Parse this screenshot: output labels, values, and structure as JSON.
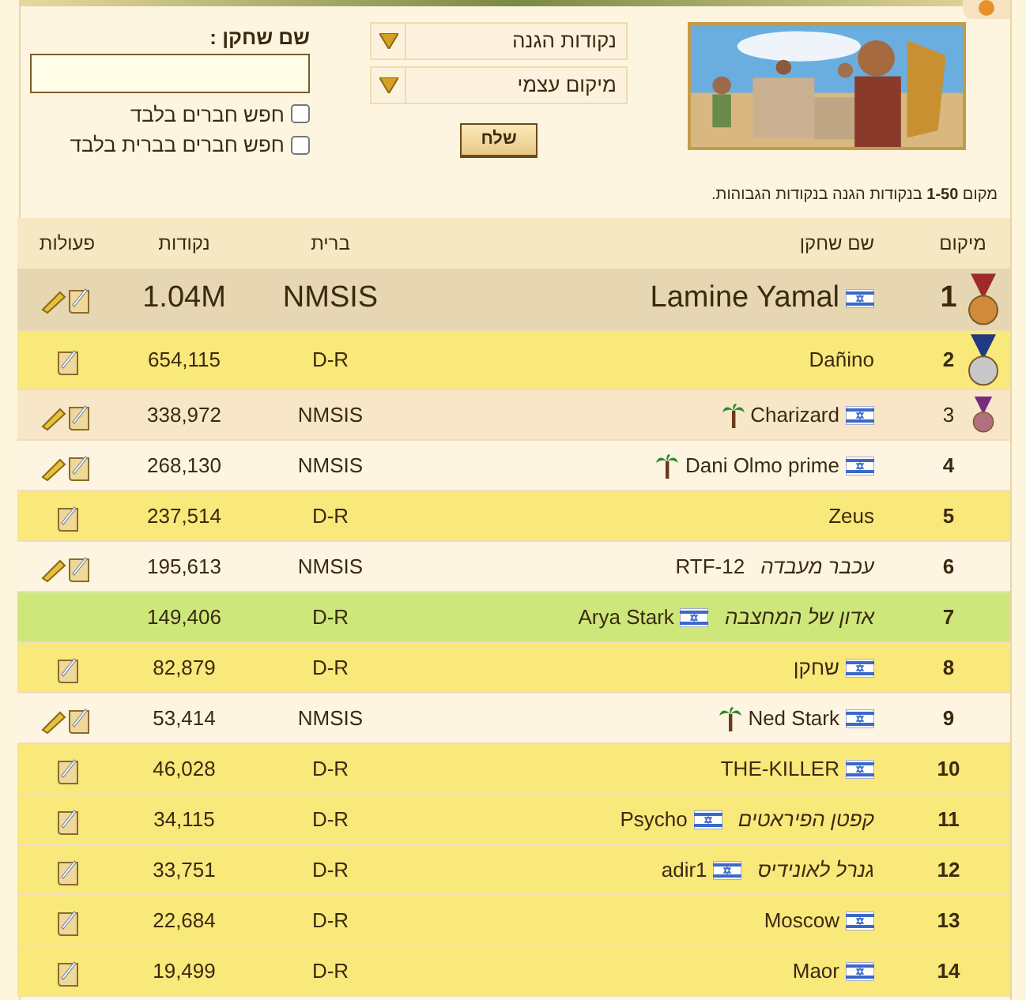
{
  "filters": {
    "selects": [
      {
        "value": "נקודות הגנה"
      },
      {
        "value": "מיקום עצמי"
      }
    ],
    "send_button": "שלח",
    "name_label": "שם שחקן :",
    "checkboxes": [
      {
        "label": "חפש חברים בלבד",
        "checked": false
      },
      {
        "label": "חפש חברים בברית בלבד",
        "checked": false
      }
    ]
  },
  "caption": "מקום **1-50** בנקודות הגנה בנקודות הגבוהות.",
  "table": {
    "columns": [
      "מיקום",
      "שם שחקן",
      "ברית",
      "נקודות",
      "פעולות"
    ],
    "rows": [
      {
        "rank": "1",
        "medal": {
          "kind": "first"
        },
        "bold": true,
        "large": true,
        "color": "#e6d6b2",
        "name": "Lamine Yamal",
        "flag": true,
        "palm": false,
        "alliance": "NMSIS",
        "points": "1.04M",
        "actions": {
          "kind": "double"
        }
      },
      {
        "rank": "2",
        "medal": {
          "kind": "second"
        },
        "bold": true,
        "large": false,
        "color": "#f9e87a",
        "name": "Dañino",
        "flag": false,
        "palm": false,
        "alliance": "D-R",
        "points": "654,115",
        "actions": {
          "kind": "single"
        }
      },
      {
        "rank": "3",
        "medal": {
          "kind": "third"
        },
        "bold": false,
        "large": false,
        "color": "#f7e7c8",
        "name": "Charizard",
        "flag": true,
        "palm": true,
        "alliance": "NMSIS",
        "points": "338,972",
        "actions": {
          "kind": "double"
        }
      },
      {
        "rank": "4",
        "bold": true,
        "large": false,
        "color": "#fdf5e2",
        "name": "Dani Olmo prime",
        "flag": true,
        "palm": true,
        "alliance": "NMSIS",
        "points": "268,130",
        "actions": {
          "kind": "double"
        }
      },
      {
        "rank": "5",
        "bold": true,
        "large": false,
        "color": "#f9e87a",
        "name": "Zeus",
        "flag": false,
        "palm": false,
        "alliance": "D-R",
        "points": "237,514",
        "actions": {
          "kind": "single"
        }
      },
      {
        "rank": "6",
        "bold": true,
        "large": false,
        "color": "#fdf5e2",
        "title": "עכבר מעבדה",
        "name": "RTF-12",
        "flag": false,
        "palm": false,
        "alliance": "NMSIS",
        "points": "195,613",
        "actions": {
          "kind": "double"
        }
      },
      {
        "rank": "7",
        "bold": true,
        "large": false,
        "color": "#cde77a",
        "title": "אדון של המחצבה",
        "name": "Arya Stark",
        "flag": true,
        "palm": false,
        "alliance": "D-R",
        "points": "149,406"
      },
      {
        "rank": "8",
        "bold": true,
        "large": false,
        "color": "#f9e87a",
        "name": "שחקן",
        "flag": true,
        "palm": false,
        "alliance": "D-R",
        "points": "82,879",
        "actions": {
          "kind": "single"
        }
      },
      {
        "rank": "9",
        "bold": true,
        "large": false,
        "color": "#fdf5e2",
        "name": "Ned Stark",
        "flag": true,
        "palm": true,
        "alliance": "NMSIS",
        "points": "53,414",
        "actions": {
          "kind": "double"
        }
      },
      {
        "rank": "10",
        "bold": true,
        "large": false,
        "color": "#f9e87a",
        "name": "THE-KILLER",
        "flag": true,
        "palm": false,
        "alliance": "D-R",
        "points": "46,028",
        "actions": {
          "kind": "single"
        }
      },
      {
        "rank": "11",
        "bold": true,
        "large": false,
        "color": "#f9e87a",
        "title": "קפטן הפיראטים",
        "name": "Psycho",
        "flag": true,
        "palm": false,
        "alliance": "D-R",
        "points": "34,115",
        "actions": {
          "kind": "single"
        }
      },
      {
        "rank": "12",
        "bold": true,
        "large": false,
        "color": "#f9e87a",
        "title": "גנרל לאונידיס",
        "name": "adir1",
        "flag": true,
        "palm": false,
        "alliance": "D-R",
        "points": "33,751",
        "actions": {
          "kind": "single"
        }
      },
      {
        "rank": "13",
        "bold": true,
        "large": false,
        "color": "#f9e87a",
        "name": "Moscow",
        "flag": true,
        "palm": false,
        "alliance": "D-R",
        "points": "22,684",
        "actions": {
          "kind": "single"
        }
      },
      {
        "rank": "14",
        "bold": true,
        "large": false,
        "color": "#f9e87a",
        "name": "Maor",
        "flag": true,
        "palm": false,
        "alliance": "D-R",
        "points": "19,499",
        "actions": {
          "kind": "single"
        }
      }
    ]
  }
}
